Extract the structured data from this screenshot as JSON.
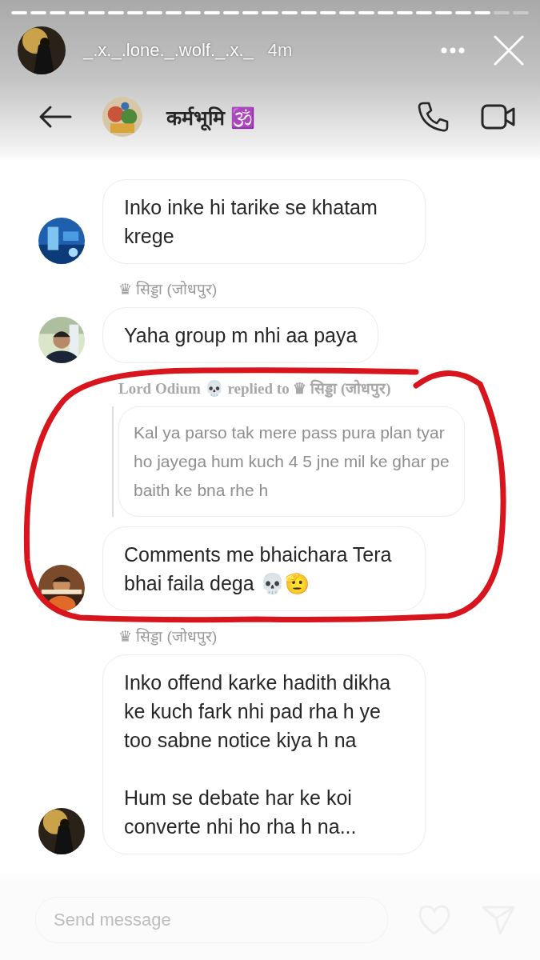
{
  "story": {
    "progress": [
      {
        "seen": true
      },
      {
        "seen": true
      },
      {
        "seen": true
      },
      {
        "seen": true
      },
      {
        "seen": true
      },
      {
        "seen": true
      },
      {
        "seen": true
      },
      {
        "seen": true
      },
      {
        "seen": true
      },
      {
        "seen": true
      },
      {
        "seen": true
      },
      {
        "seen": true
      },
      {
        "seen": true
      },
      {
        "seen": true
      },
      {
        "seen": true
      },
      {
        "seen": true
      },
      {
        "seen": true
      },
      {
        "seen": true
      },
      {
        "seen": true
      },
      {
        "seen": true
      },
      {
        "seen": true
      },
      {
        "seen": true
      },
      {
        "seen": true
      },
      {
        "seen": true
      },
      {
        "seen": true
      },
      {
        "seen": false
      },
      {
        "seen": false
      }
    ],
    "username": "_.x._.lone._.wolf._.x._",
    "time": "4m"
  },
  "chat_header": {
    "title": "कर्मभूमि 🕉️"
  },
  "messages": [
    {
      "kind": "text",
      "text": "Inko inke hi tarike se khatam krege"
    },
    {
      "kind": "text",
      "sender": "♛ सिड्डा (जोधपुर)",
      "text": "Yaha group m nhi aa paya"
    },
    {
      "kind": "reply",
      "sender": "Lord Odium 💀 replied to ♛ सिड्डा (जोधपुर)",
      "quoted": "Kal ya parso tak mere pass pura plan tyar ho jayega hum kuch 4 5 jne mil ke ghar pe baith ke bna rhe h",
      "text": "Comments me bhaichara Tera bhai faila dega 💀🫡"
    },
    {
      "kind": "text",
      "sender": "♛ सिड्डा (जोधपुर)",
      "text": "Inko offend karke hadith dikha ke kuch fark nhi pad rha h ye too sabne notice kiya h na\n\nHum se debate har ke koi converte nhi ho rha h na..."
    }
  ],
  "composer": {
    "placeholder": "Send message"
  }
}
